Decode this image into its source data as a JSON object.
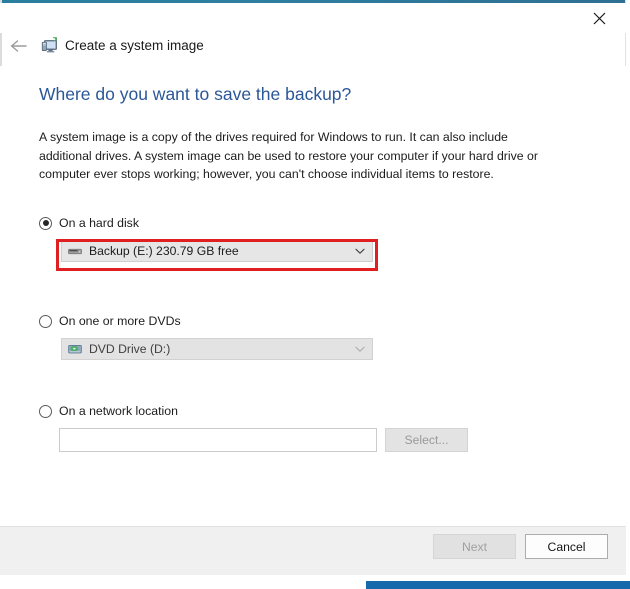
{
  "window": {
    "close_label": "✕",
    "back_label": "←",
    "app_icon_name": "create-system-image-icon",
    "app_title": "Create a system image",
    "accent_color": "#2a7f9e"
  },
  "page": {
    "heading": "Where do you want to save the backup?",
    "heading_color": "#2b5797",
    "intro_paragraph": "A system image is a copy of the drives required for Windows to run. It can also include additional drives. A system image can be used to restore your computer if your hard drive or computer ever stops working; however, you can't choose individual items to restore."
  },
  "options": {
    "hard_disk": {
      "radio_label": "On a hard disk",
      "selected": true,
      "combo_value": "Backup (E:)  230.79 GB free",
      "combo_icon_name": "hard-disk-icon",
      "chevron_icon_name": "chevron-down-icon",
      "highlight_color": "#e02020",
      "highlighted": true
    },
    "dvd": {
      "radio_label": "On one or more DVDs",
      "selected": false,
      "combo_value": "DVD Drive (D:)",
      "combo_icon_name": "dvd-drive-icon",
      "chevron_icon_name": "chevron-down-icon",
      "disabled": true
    },
    "network": {
      "radio_label": "On a network location",
      "selected": false,
      "input_value": "",
      "input_placeholder": "",
      "select_button_label": "Select...",
      "select_button_disabled": true
    }
  },
  "footer": {
    "next_label": "Next",
    "next_disabled": true,
    "cancel_label": "Cancel",
    "cancel_disabled": false
  }
}
